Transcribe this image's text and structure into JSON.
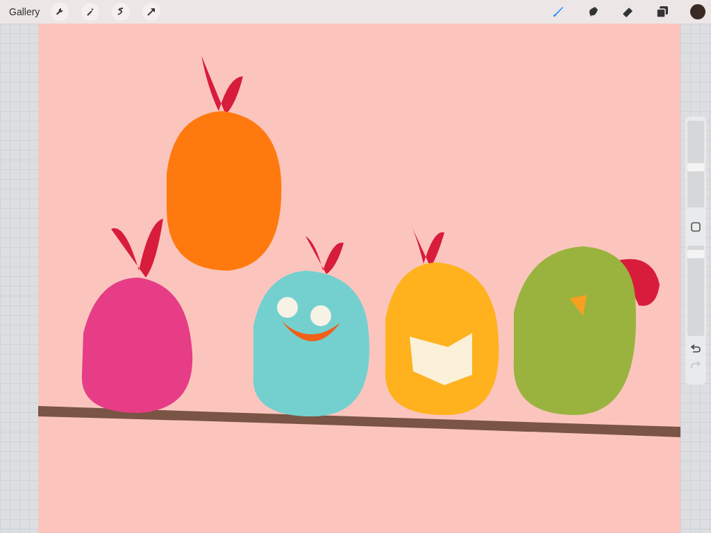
{
  "toolbar": {
    "gallery": "Gallery",
    "actions": [
      {
        "kind": "wrench"
      },
      {
        "kind": "wand"
      },
      {
        "kind": "selection"
      },
      {
        "kind": "transform"
      }
    ],
    "tools": [
      {
        "kind": "brush",
        "selected": true
      },
      {
        "kind": "smudge",
        "selected": false
      },
      {
        "kind": "eraser",
        "selected": false
      },
      {
        "kind": "layers",
        "selected": false
      }
    ],
    "color": "#3a2a24"
  },
  "sidebar": {
    "size_slider": {
      "level": 0.46
    },
    "opacity_slider": {
      "level": 0.95
    },
    "undo": {
      "disabled": false
    },
    "redo": {
      "disabled": true
    }
  }
}
